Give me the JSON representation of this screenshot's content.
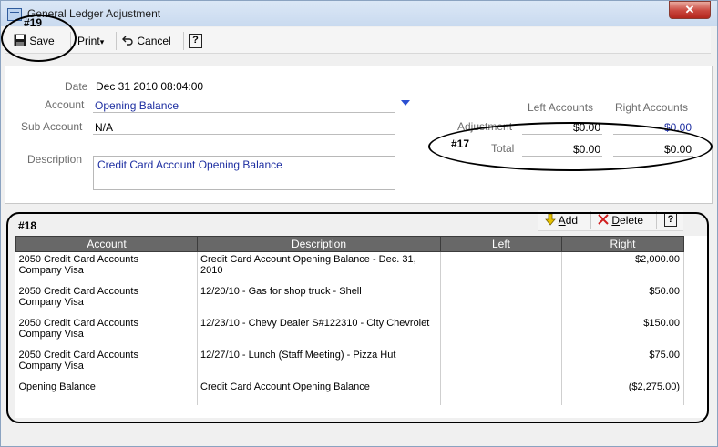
{
  "window": {
    "title": "General Ledger Adjustment",
    "close_glyph": "✕"
  },
  "toolbar": {
    "save": {
      "prefix": "",
      "underline": "S",
      "rest": "ave"
    },
    "print": {
      "underline": "P",
      "rest": "rint",
      "caret": "▾"
    },
    "cancel": {
      "underline": "C",
      "rest": "ancel"
    },
    "help_glyph": "?"
  },
  "form": {
    "date_label": "Date",
    "date_value": "Dec 31 2010 08:04:00",
    "account_label": "Account",
    "account_value": "Opening Balance",
    "subaccount_label": "Sub Account",
    "subaccount_value": "N/A",
    "description_label": "Description",
    "description_value": "Credit Card Account Opening Balance"
  },
  "totals": {
    "left_header": "Left Accounts",
    "right_header": "Right Accounts",
    "adjustment_label": "Adjustment",
    "adjustment_left": "$0.00",
    "adjustment_right": "$0.00",
    "total_label": "Total",
    "total_left": "$0.00",
    "total_right": "$0.00"
  },
  "grid_toolbar": {
    "add": {
      "underline": "A",
      "rest": "dd"
    },
    "delete": {
      "underline": "D",
      "rest": "elete"
    },
    "help_glyph": "?"
  },
  "grid": {
    "columns": [
      "Account",
      "Description",
      "Left",
      "Right"
    ],
    "rows": [
      {
        "account": "2050 Credit Card Accounts",
        "account2": "Company Visa",
        "description": "Credit Card Account Opening Balance - Dec. 31, 2010",
        "left": "",
        "right": "$2,000.00"
      },
      {
        "account": "2050 Credit Card Accounts",
        "account2": "Company Visa",
        "description": "12/20/10 - Gas for shop truck - Shell",
        "left": "",
        "right": "$50.00"
      },
      {
        "account": "2050 Credit Card Accounts",
        "account2": "Company Visa",
        "description": "12/23/10 - Chevy Dealer S#122310 - City Chevrolet",
        "left": "",
        "right": "$150.00"
      },
      {
        "account": "2050 Credit Card Accounts",
        "account2": "Company Visa",
        "description": "12/27/10 - Lunch (Staff Meeting) - Pizza Hut",
        "left": "",
        "right": "$75.00"
      },
      {
        "account": "Opening Balance",
        "account2": "",
        "description": "Credit Card Account Opening Balance",
        "left": "",
        "right": "($2,275.00)"
      }
    ]
  },
  "annotations": {
    "save_tag": "#19",
    "totals_tag": "#17",
    "grid_tag": "#18"
  }
}
